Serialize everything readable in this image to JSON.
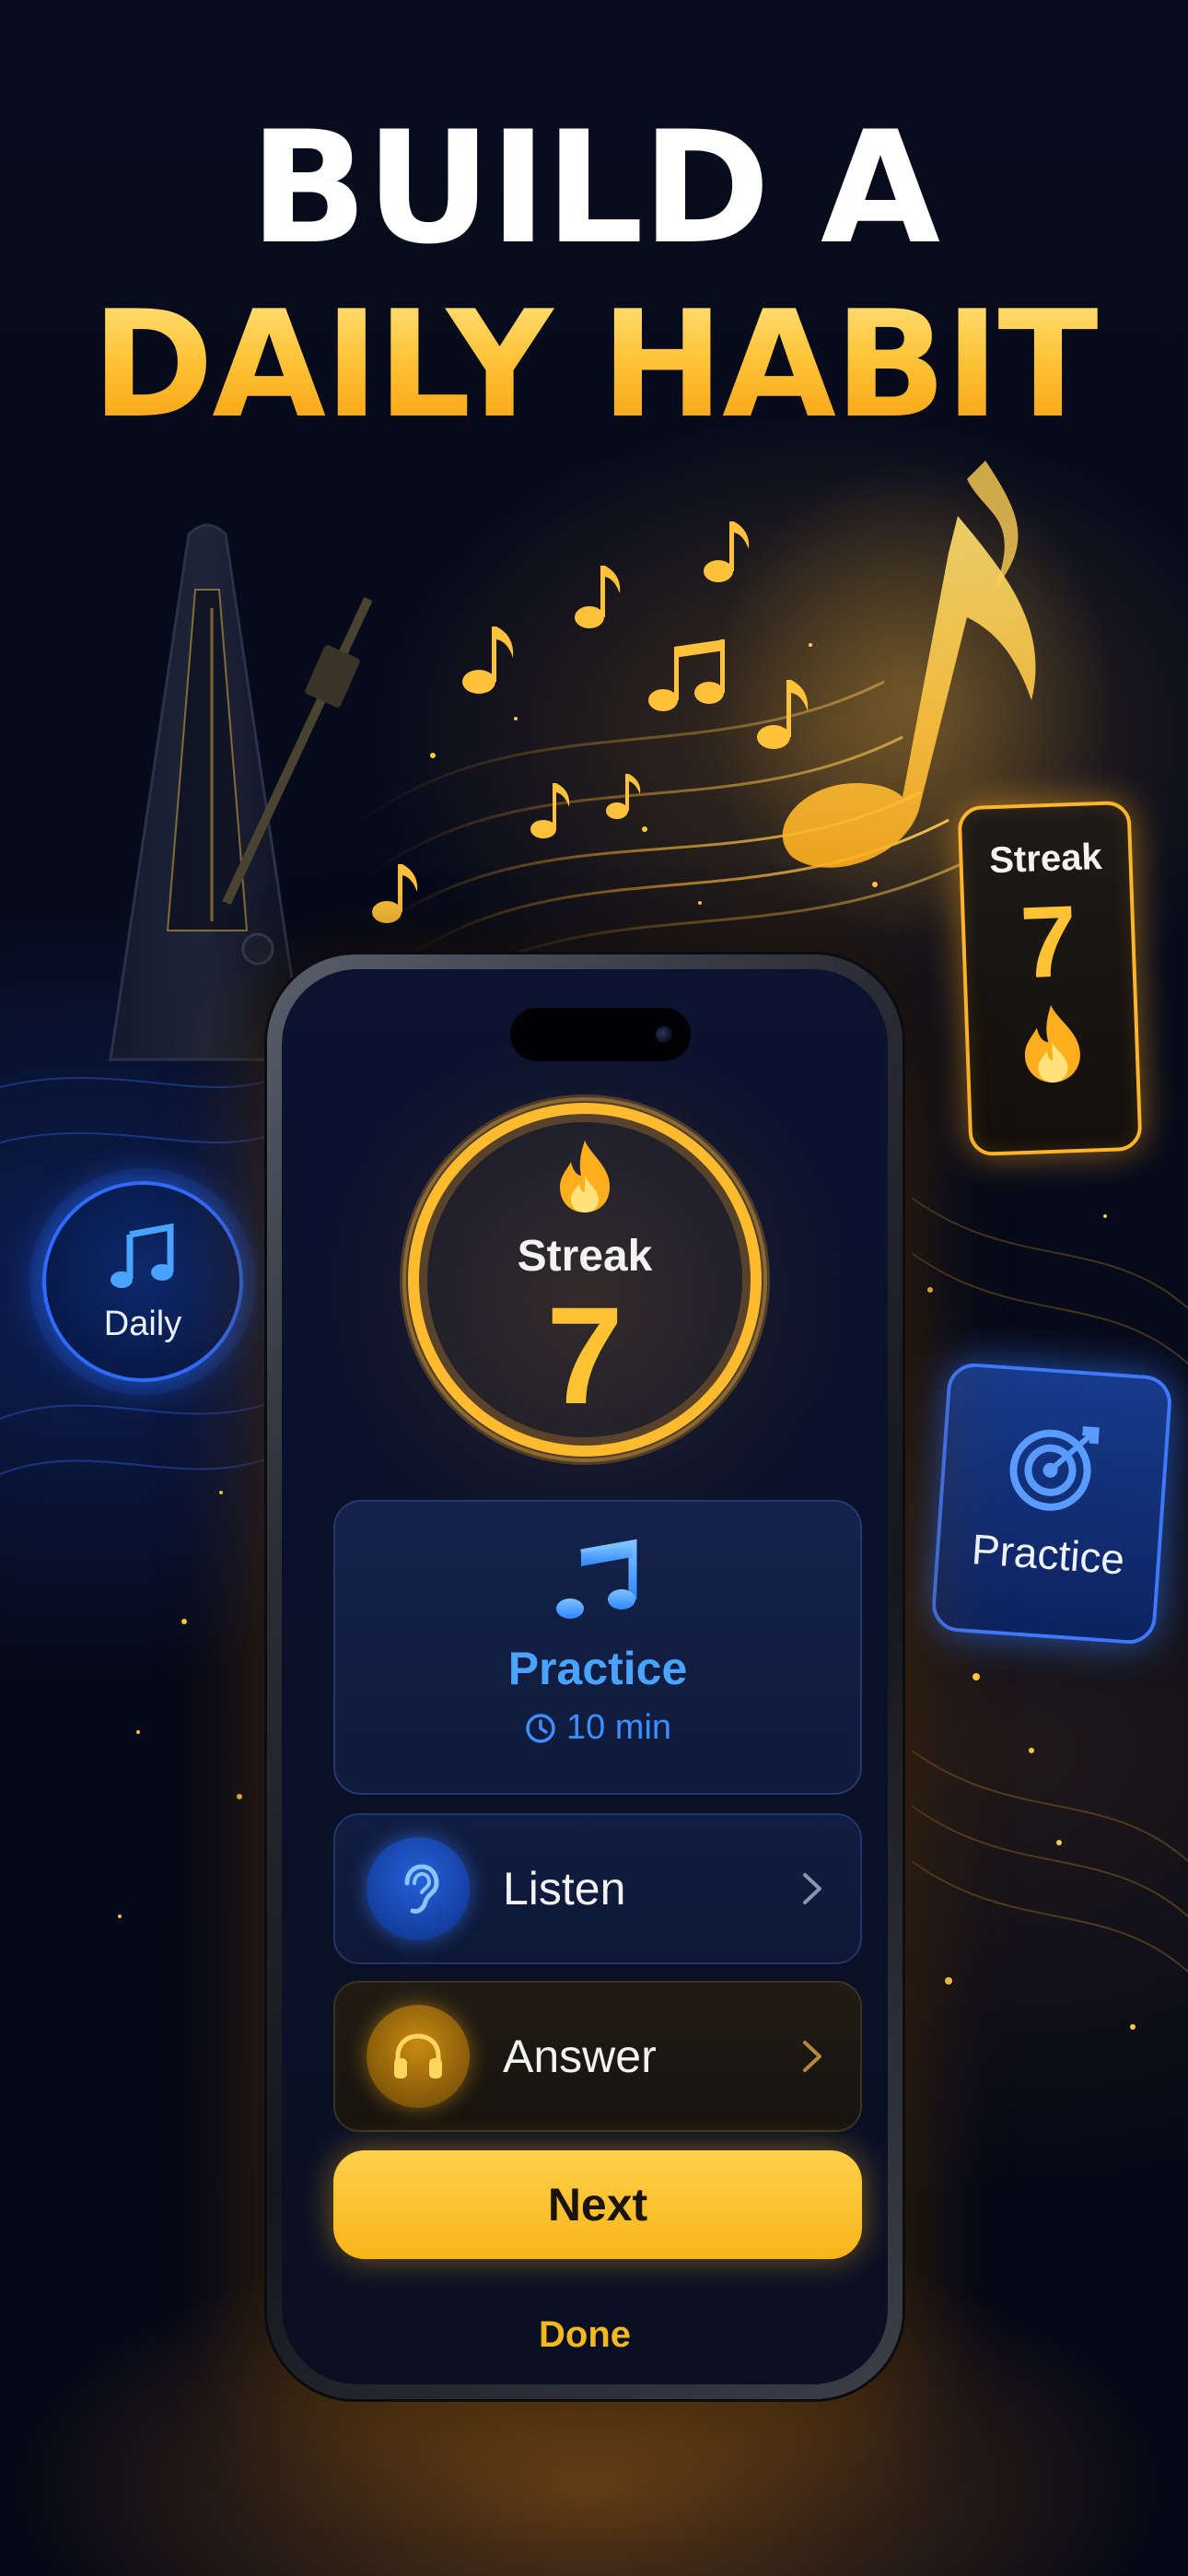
{
  "headline": {
    "line1": "BUILD A",
    "line2": "DAILY HABIT"
  },
  "floating_badges": {
    "streak": {
      "label": "Streak",
      "value": "7",
      "icon": "flame-icon"
    },
    "daily": {
      "label": "Daily",
      "icon": "music-note-icon"
    },
    "practice": {
      "label": "Practice",
      "icon": "target-icon"
    }
  },
  "app": {
    "streak": {
      "label": "Streak",
      "value": "7",
      "icon": "flame-icon"
    },
    "practice_card": {
      "title": "Practice",
      "duration": "10 min",
      "icon": "music-note-icon",
      "duration_icon": "clock-icon"
    },
    "rows": [
      {
        "label": "Listen",
        "icon": "ear-icon",
        "trailing_icon": "chevron-right-icon"
      },
      {
        "label": "Answer",
        "icon": "headphones-icon",
        "trailing_icon": "chevron-right-icon"
      }
    ],
    "primary_button": "Next",
    "secondary_link": "Done"
  },
  "colors": {
    "accent_gold": "#ffc233",
    "accent_blue": "#3d8fff",
    "background": "#050816"
  }
}
